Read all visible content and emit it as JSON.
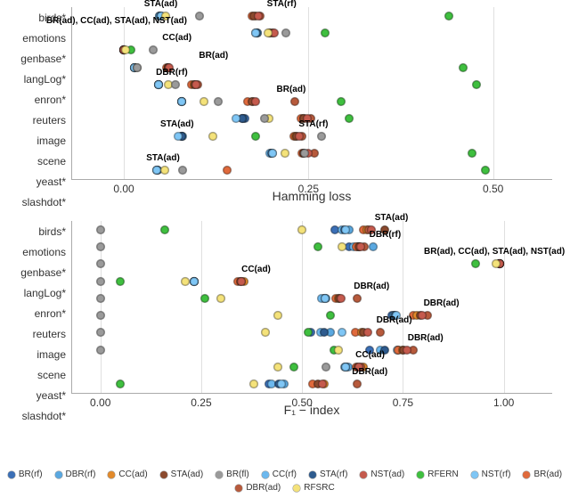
{
  "palette": {
    "BR(rf)": "#3B6FB6",
    "DBR(rf)": "#5AA8E0",
    "CC(ad)": "#E28A2B",
    "STA(ad)": "#8B4A2E",
    "BR(fl)": "#9a9a9a",
    "CC(rf)": "#6CB8EE",
    "STA(rf)": "#2E5B8E",
    "NST(ad)": "#C55A4D",
    "RFERN": "#3FBF3F",
    "NST(rf)": "#7FC6F5",
    "BR(ad)": "#E06A3C",
    "DBR(ad)": "#B75A3C",
    "RFSRC": "#F4E27A"
  },
  "legend_order": [
    "BR(rf)",
    "DBR(rf)",
    "CC(ad)",
    "STA(ad)",
    "BR(fl)",
    "CC(rf)",
    "STA(rf)",
    "NST(ad)",
    "RFERN",
    "NST(rf)",
    "BR(ad)",
    "DBR(ad)",
    "RFSRC"
  ],
  "chart_data": [
    {
      "type": "scatter",
      "xlabel": "Hamming loss",
      "xlim": [
        -0.07,
        0.58
      ],
      "categories": [
        "birds*",
        "emotions",
        "genbase*",
        "langLog*",
        "enron*",
        "reuters",
        "image",
        "scene",
        "yeast*",
        "slashdot*"
      ],
      "xticks": [
        0.0,
        0.25,
        0.5
      ],
      "xtick_labels": [
        "0.00",
        "0.25",
        "0.50"
      ],
      "annotations": [
        {
          "x": 0.05,
          "cat": "birds*",
          "text": "STA(ad)",
          "dy": -8
        },
        {
          "x": 0.192,
          "cat": "birds*",
          "text": "STA(rf)",
          "dy": -8,
          "dx": 18
        },
        {
          "x": -0.005,
          "cat": "emotions",
          "text": "BR(ad), CC(ad), STA(ad), NST(ad)",
          "dy": -8,
          "dx": -4
        },
        {
          "x": 0.055,
          "cat": "genbase*",
          "text": "CC(ad)",
          "dy": -8,
          "dx": 14
        },
        {
          "x": 0.095,
          "cat": "langLog*",
          "text": "BR(ad)",
          "dy": -8,
          "dx": 22
        },
        {
          "x": 0.065,
          "cat": "enron*",
          "text": "DBR(rf)",
          "dy": -8
        },
        {
          "x": 0.2,
          "cat": "reuters",
          "text": "BR(ad)",
          "dy": -8,
          "dx": 22
        },
        {
          "x": 0.072,
          "cat": "scene",
          "text": "STA(ad)",
          "dy": -8
        },
        {
          "x": 0.235,
          "cat": "scene",
          "text": "STA(rf)",
          "dy": -8,
          "dx": 18
        },
        {
          "x": 0.053,
          "cat": "slashdot*",
          "text": "STA(ad)",
          "dy": -8
        }
      ],
      "data": {
        "birds*": {
          "BR(rf)": 0.048,
          "CC(rf)": 0.048,
          "DBR(rf)": 0.049,
          "STA(rf)": 0.05,
          "NST(rf)": 0.05,
          "BR(ad)": 0.173,
          "CC(ad)": 0.178,
          "DBR(ad)": 0.184,
          "STA(ad)": 0.176,
          "NST(ad)": 0.182,
          "RFERN": 0.44,
          "RFSRC": 0.057,
          "BR(fl)": 0.102
        },
        "emotions": {
          "BR(rf)": 0.181,
          "CC(rf)": 0.178,
          "DBR(rf)": 0.181,
          "STA(rf)": 0.18,
          "NST(rf)": 0.178,
          "BR(ad)": 0.196,
          "CC(ad)": 0.198,
          "DBR(ad)": 0.202,
          "STA(ad)": 0.2,
          "NST(ad)": 0.204,
          "RFERN": 0.273,
          "RFSRC": 0.195,
          "BR(fl)": 0.22
        },
        "genbase*": {
          "BR(rf)": 0.0,
          "CC(rf)": 0.0,
          "DBR(rf)": 0.0,
          "STA(rf)": 0.0,
          "NST(rf)": 0.0,
          "BR(ad)": 0.0,
          "CC(ad)": 0.0,
          "DBR(ad)": 0.0,
          "STA(ad)": 0.0,
          "NST(ad)": 0.0,
          "RFERN": 0.01,
          "RFSRC": 0.002,
          "BR(fl)": 0.04
        },
        "langLog*": {
          "BR(rf)": 0.015,
          "CC(rf)": 0.015,
          "DBR(rf)": 0.015,
          "STA(rf)": 0.015,
          "NST(rf)": 0.015,
          "BR(ad)": 0.058,
          "CC(ad)": 0.06,
          "DBR(ad)": 0.06,
          "STA(ad)": 0.06,
          "NST(ad)": 0.062,
          "RFERN": 0.46,
          "RFSRC": 0.018,
          "BR(fl)": 0.018
        },
        "enron*": {
          "BR(rf)": 0.047,
          "CC(rf)": 0.047,
          "DBR(rf)": 0.047,
          "STA(rf)": 0.047,
          "NST(rf)": 0.047,
          "BR(ad)": 0.092,
          "CC(ad)": 0.095,
          "DBR(ad)": 0.1,
          "STA(ad)": 0.096,
          "NST(ad)": 0.098,
          "RFERN": 0.478,
          "RFSRC": 0.06,
          "BR(fl)": 0.07
        },
        "reuters": {
          "BR(rf)": 0.078,
          "CC(rf)": 0.078,
          "DBR(rf)": 0.078,
          "STA(rf)": 0.078,
          "NST(rf)": 0.078,
          "BR(ad)": 0.168,
          "CC(ad)": 0.175,
          "DBR(ad)": 0.231,
          "STA(ad)": 0.174,
          "NST(ad)": 0.178,
          "RFERN": 0.294,
          "RFSRC": 0.108,
          "BR(fl)": 0.128
        },
        "image": {
          "BR(rf)": 0.164,
          "CC(rf)": 0.161,
          "DBR(rf)": 0.16,
          "STA(rf)": 0.16,
          "NST(rf)": 0.152,
          "BR(ad)": 0.24,
          "CC(ad)": 0.244,
          "DBR(ad)": 0.253,
          "STA(ad)": 0.244,
          "NST(ad)": 0.248,
          "RFERN": 0.305,
          "RFSRC": 0.197,
          "BR(fl)": 0.19
        },
        "scene": {
          "BR(rf)": 0.078,
          "CC(rf)": 0.079,
          "DBR(rf)": 0.078,
          "STA(rf)": 0.078,
          "NST(rf)": 0.074,
          "BR(ad)": 0.23,
          "CC(ad)": 0.233,
          "DBR(ad)": 0.241,
          "STA(ad)": 0.234,
          "NST(ad)": 0.238,
          "RFERN": 0.178,
          "RFSRC": 0.12,
          "BR(fl)": 0.268
        },
        "yeast*": {
          "BR(rf)": 0.199,
          "CC(rf)": 0.198,
          "DBR(rf)": 0.201,
          "STA(rf)": 0.2,
          "NST(rf)": 0.201,
          "BR(ad)": 0.241,
          "CC(ad)": 0.244,
          "DBR(ad)": 0.258,
          "STA(ad)": 0.243,
          "NST(ad)": 0.249,
          "RFERN": 0.471,
          "RFSRC": 0.218,
          "BR(fl)": 0.245
        },
        "slashdot*": {
          "BR(rf)": 0.046,
          "CC(rf)": 0.044,
          "DBR(rf)": 0.046,
          "STA(rf)": 0.045,
          "NST(rf)": 0.045,
          "BR(ad)": 0.14,
          "RFERN": 0.49,
          "RFSRC": 0.055,
          "BR(fl)": 0.08
        }
      }
    },
    {
      "type": "scatter",
      "xlabel": "F₁ − index",
      "xlim": [
        -0.07,
        1.12
      ],
      "categories": [
        "birds*",
        "emotions",
        "genbase*",
        "langLog*",
        "enron*",
        "reuters",
        "image",
        "scene",
        "yeast*",
        "slashdot*"
      ],
      "xticks": [
        0.0,
        0.25,
        0.5,
        0.75,
        1.0
      ],
      "xtick_labels": [
        "0.00",
        "0.25",
        "0.50",
        "0.75",
        "1.00"
      ],
      "annotations": [
        {
          "x": 0.695,
          "cat": "birds*",
          "text": "STA(ad)",
          "dy": -8,
          "dx": 12
        },
        {
          "x": 0.675,
          "cat": "emotions",
          "text": "DBR(rf)",
          "dy": -8,
          "dx": 14
        },
        {
          "x": 0.99,
          "cat": "genbase*",
          "text": "BR(ad), CC(ad), STA(ad), NST(ad)",
          "dy": -8,
          "dx": -6
        },
        {
          "x": 0.355,
          "cat": "langLog*",
          "text": "CC(ad)",
          "dy": -8,
          "dx": 14
        },
        {
          "x": 0.637,
          "cat": "enron*",
          "text": "DBR(ad)",
          "dy": -8,
          "dx": 16
        },
        {
          "x": 0.81,
          "cat": "reuters",
          "text": "DBR(ad)",
          "dy": -8,
          "dx": 16
        },
        {
          "x": 0.693,
          "cat": "image",
          "text": "DBR(ad)",
          "dy": -8,
          "dx": 16
        },
        {
          "x": 0.775,
          "cat": "scene",
          "text": "DBR(ad)",
          "dy": -8,
          "dx": 14
        },
        {
          "x": 0.651,
          "cat": "yeast*",
          "text": "CC(ad)",
          "dy": -8,
          "dx": 8
        },
        {
          "x": 0.637,
          "cat": "slashdot*",
          "text": "DBR(ad)",
          "dy": -8,
          "dx": 14
        }
      ],
      "data": {
        "birds*": {
          "BR(rf)": 0.582,
          "CC(rf)": 0.598,
          "DBR(rf)": 0.616,
          "STA(rf)": 0.605,
          "NST(rf)": 0.608,
          "BR(ad)": 0.651,
          "CC(ad)": 0.66,
          "DBR(ad)": 0.665,
          "STA(ad)": 0.704,
          "NST(ad)": 0.672,
          "RFERN": 0.16,
          "RFSRC": 0.5,
          "BR(fl)": 0.0
        },
        "emotions": {
          "BR(rf)": 0.617,
          "CC(rf)": 0.628,
          "DBR(rf)": 0.676,
          "STA(rf)": 0.636,
          "NST(rf)": 0.64,
          "BR(ad)": 0.634,
          "CC(ad)": 0.644,
          "DBR(ad)": 0.655,
          "STA(ad)": 0.64,
          "NST(ad)": 0.646,
          "RFERN": 0.54,
          "RFSRC": 0.6,
          "BR(fl)": 0.0
        },
        "genbase*": {
          "BR(rf)": 0.99,
          "CC(rf)": 0.99,
          "DBR(rf)": 0.99,
          "STA(rf)": 0.99,
          "NST(rf)": 0.99,
          "BR(ad)": 0.99,
          "CC(ad)": 0.99,
          "DBR(ad)": 0.99,
          "STA(ad)": 0.99,
          "NST(ad)": 0.99,
          "RFERN": 0.93,
          "RFSRC": 0.98,
          "BR(fl)": 0.0
        },
        "langLog*": {
          "BR(rf)": 0.232,
          "CC(rf)": 0.232,
          "DBR(rf)": 0.232,
          "STA(rf)": 0.232,
          "NST(rf)": 0.232,
          "BR(ad)": 0.34,
          "CC(ad)": 0.355,
          "DBR(ad)": 0.35,
          "STA(ad)": 0.348,
          "NST(ad)": 0.35,
          "RFERN": 0.05,
          "RFSRC": 0.21,
          "BR(fl)": 0.0
        },
        "enron*": {
          "BR(rf)": 0.554,
          "CC(rf)": 0.548,
          "DBR(rf)": 0.56,
          "STA(rf)": 0.556,
          "NST(rf)": 0.558,
          "BR(ad)": 0.583,
          "CC(ad)": 0.59,
          "DBR(ad)": 0.637,
          "STA(ad)": 0.592,
          "NST(ad)": 0.596,
          "RFERN": 0.258,
          "RFSRC": 0.298,
          "BR(fl)": 0.0
        },
        "reuters": {
          "BR(rf)": 0.722,
          "CC(rf)": 0.728,
          "DBR(rf)": 0.73,
          "STA(rf)": 0.732,
          "NST(rf)": 0.734,
          "BR(ad)": 0.775,
          "CC(ad)": 0.785,
          "DBR(ad)": 0.81,
          "STA(ad)": 0.793,
          "NST(ad)": 0.798,
          "RFERN": 0.57,
          "RFSRC": 0.44,
          "BR(fl)": 0.0
        },
        "image": {
          "BR(rf)": 0.522,
          "CC(rf)": 0.545,
          "DBR(rf)": 0.57,
          "STA(rf)": 0.555,
          "NST(rf)": 0.6,
          "BR(ad)": 0.633,
          "CC(ad)": 0.648,
          "DBR(ad)": 0.693,
          "STA(ad)": 0.652,
          "NST(ad)": 0.662,
          "RFERN": 0.515,
          "RFSRC": 0.41,
          "BR(fl)": 0.0
        },
        "scene": {
          "BR(rf)": 0.668,
          "CC(rf)": 0.694,
          "DBR(rf)": 0.738,
          "STA(rf)": 0.704,
          "NST(rf)": 0.736,
          "BR(ad)": 0.739,
          "CC(ad)": 0.749,
          "DBR(ad)": 0.775,
          "STA(ad)": 0.752,
          "NST(ad)": 0.76,
          "RFERN": 0.58,
          "RFSRC": 0.59,
          "BR(fl)": 0.0
        },
        "yeast*": {
          "BR(rf)": 0.611,
          "CC(rf)": 0.606,
          "DBR(rf)": 0.615,
          "STA(rf)": 0.607,
          "NST(rf)": 0.608,
          "BR(ad)": 0.634,
          "CC(ad)": 0.651,
          "DBR(ad)": 0.645,
          "STA(ad)": 0.638,
          "NST(ad)": 0.641,
          "RFERN": 0.48,
          "RFSRC": 0.44,
          "BR(fl)": 0.56
        },
        "slashdot*": {
          "BR(rf)": 0.417,
          "CC(rf)": 0.424,
          "DBR(rf)": 0.455,
          "STA(rf)": 0.443,
          "NST(rf)": 0.448,
          "BR(ad)": 0.525,
          "CC(ad)": 0.555,
          "DBR(ad)": 0.637,
          "STA(ad)": 0.54,
          "NST(ad)": 0.55,
          "RFERN": 0.05,
          "RFSRC": 0.38
        }
      }
    }
  ]
}
